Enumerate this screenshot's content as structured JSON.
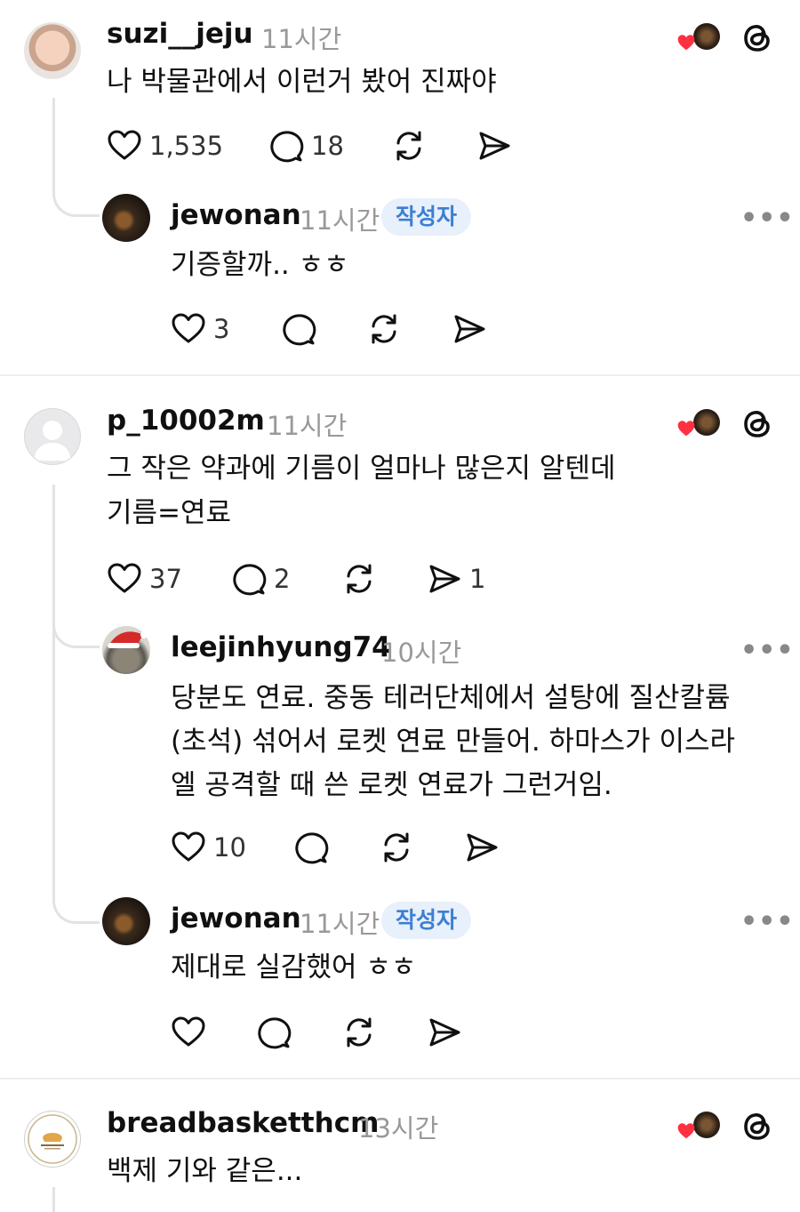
{
  "colors": {
    "accent_badge_bg": "#e8f0fb",
    "accent_badge_text": "#3b7fd3",
    "heart": "#ff3040",
    "muted": "#999999"
  },
  "comments": [
    {
      "username": "suzi__jeju",
      "time": "11시간",
      "text": "나 박물관에서 이런거 봤어 진짜야",
      "likes": "1,535",
      "replies": "18",
      "avatar": "baby-photo"
    },
    {
      "username": "jewonan",
      "time": "11시간",
      "badge": "작성자",
      "text": "기증할까.. ㅎㅎ",
      "likes": "3",
      "avatar": "dark-photo"
    },
    {
      "username": "p_10002m",
      "time": "11시간",
      "text_lines": [
        "그 작은 약과에 기름이 얼마나 많은지 알텐데",
        "기름=연료"
      ],
      "likes": "37",
      "replies": "2",
      "shares": "1",
      "avatar": "default-avatar"
    },
    {
      "username": "leejinhyung74",
      "time": "10시간",
      "text_lines": [
        "당분도 연료. 중동 테러단체에서 설탕에 질산칼륨",
        "(초석) 섞어서 로켓 연료 만들어. 하마스가 이스라",
        "엘 공격할 때 쓴 로켓 연료가 그런거임."
      ],
      "likes": "10",
      "avatar": "santa-photo"
    },
    {
      "username": "jewonan",
      "time": "11시간",
      "badge": "작성자",
      "text": "제대로 실감했어 ㅎㅎ",
      "avatar": "dark-photo"
    },
    {
      "username": "breadbasketthcm",
      "time": "13시간",
      "text": "백제 기와 같은...",
      "avatar": "bread-logo"
    }
  ],
  "icons": [
    "heart-icon",
    "comment-icon",
    "repost-icon",
    "share-icon",
    "threads-icon",
    "more-icon"
  ]
}
